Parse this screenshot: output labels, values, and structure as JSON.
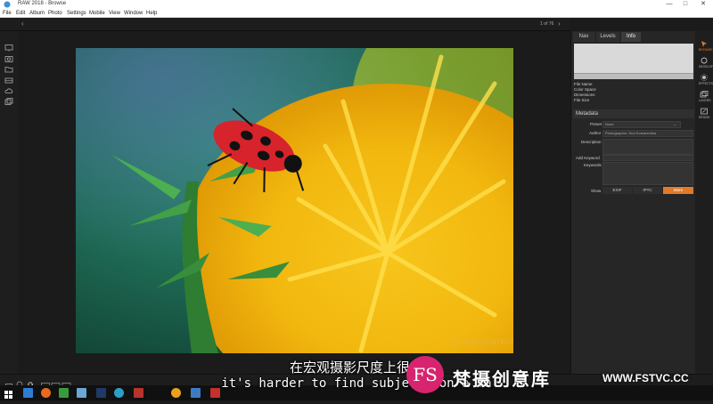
{
  "window": {
    "title": "RAW 2018 - Browse",
    "controls": [
      "—",
      "□",
      "✕"
    ]
  },
  "menu": [
    "File",
    "Edit",
    "Album",
    "Photo",
    "Settings",
    "Mobile",
    "View",
    "Window",
    "Help"
  ],
  "browser": {
    "page_counter": "1 of 76"
  },
  "panel": {
    "tabs": [
      "Nav",
      "Levels",
      "Info"
    ],
    "active_tab": "Info",
    "info_labels": [
      "File Name",
      "Color Space",
      "Dimensions",
      "File Size"
    ],
    "metadata": {
      "header": "Metadata",
      "preset_label": "Preset",
      "preset_value": "None",
      "author_label": "Author",
      "author_value": "Photographer: Don Komarechka",
      "description_label": "Description",
      "add_keyword_label": "Add Keyword",
      "keywords_label": "Keywords",
      "show_label": "Show",
      "buttons": [
        "EXIF",
        "IPTC",
        "More"
      ],
      "active_button": "More"
    }
  },
  "right_strip": [
    "BROWSE",
    "DEVELOP",
    "EFFECTS",
    "LAYERS",
    "RESIZE"
  ],
  "photo": {
    "signature": "Don Komarechka"
  },
  "overlay": {
    "subtitle_cn": "在宏观摄影尺度上很难",
    "subtitle_en": "it's harder to find subjects on a ma",
    "logo_text": "FS",
    "brand_cn": "梵摄创意库",
    "url": "WWW.FSTVC.CC"
  },
  "colors": {
    "accent": "#e07a2a",
    "logo": "#d8246f"
  }
}
